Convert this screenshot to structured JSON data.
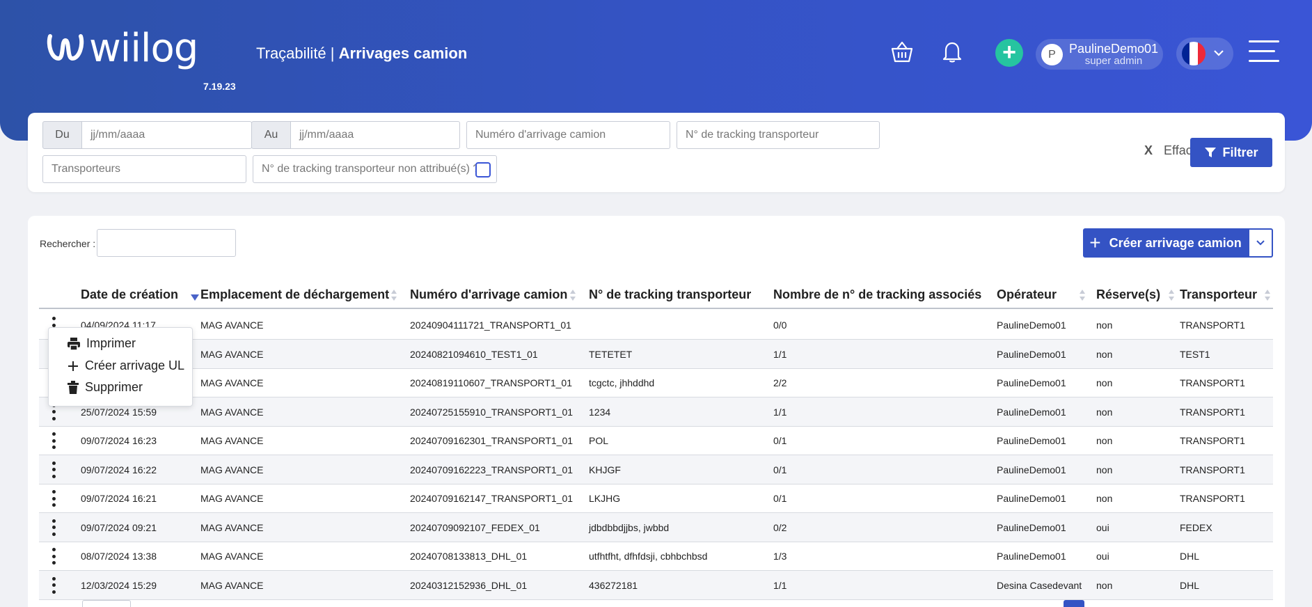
{
  "app": {
    "logo_text": "wiilog",
    "version": "7.19.23",
    "title_section": "Traçabilité |",
    "title_page": "Arrivages camion"
  },
  "header": {
    "user_initial": "P",
    "user_name": "PaulineDemo01",
    "user_role": "super admin",
    "add_label": "+",
    "language_flag_colors": [
      "#002395",
      "#ffffff",
      "#ed2939"
    ]
  },
  "filters": {
    "from_label": "Du",
    "from_placeholder": "jj/mm/aaaa",
    "to_label": "Au",
    "to_placeholder": "jj/mm/aaaa",
    "arrival_number_placeholder": "Numéro d'arrivage camion",
    "tracking_placeholder": "N° de tracking transporteur",
    "carriers_placeholder": "Transporteurs",
    "unassigned_tracking_label": "N° de tracking transporteur non attribué(s) ?",
    "clear_x": "X",
    "clear_label": "Effacer",
    "filter_label": "Filtrer"
  },
  "table_toolbar": {
    "search_label": "Rechercher :",
    "create_label": "Créer arrivage camion"
  },
  "table": {
    "columns": [
      "Date de création",
      "Emplacement de déchargement",
      "Numéro d'arrivage camion",
      "N° de tracking transporteur",
      "Nombre de n° de tracking associés",
      "Opérateur",
      "Réserve(s)",
      "Transporteur"
    ],
    "rows": [
      {
        "date": "04/09/2024 11:17",
        "location": "MAG AVANCE",
        "number": "20240904111721_TRANSPORT1_01",
        "tracking": "",
        "count": "0/0",
        "operator": "PaulineDemo01",
        "reserve": "non",
        "carrier": "TRANSPORT1"
      },
      {
        "date": "",
        "location": "MAG AVANCE",
        "number": "20240821094610_TEST1_01",
        "tracking": "TETETET",
        "count": "1/1",
        "operator": "PaulineDemo01",
        "reserve": "non",
        "carrier": "TEST1"
      },
      {
        "date": "",
        "location": "MAG AVANCE",
        "number": "20240819110607_TRANSPORT1_01",
        "tracking": "tcgctc, jhhddhd",
        "count": "2/2",
        "operator": "PaulineDemo01",
        "reserve": "non",
        "carrier": "TRANSPORT1"
      },
      {
        "date": "25/07/2024 15:59",
        "location": "MAG AVANCE",
        "number": "20240725155910_TRANSPORT1_01",
        "tracking": "1234",
        "count": "1/1",
        "operator": "PaulineDemo01",
        "reserve": "non",
        "carrier": "TRANSPORT1"
      },
      {
        "date": "09/07/2024 16:23",
        "location": "MAG AVANCE",
        "number": "20240709162301_TRANSPORT1_01",
        "tracking": "POL",
        "count": "0/1",
        "operator": "PaulineDemo01",
        "reserve": "non",
        "carrier": "TRANSPORT1"
      },
      {
        "date": "09/07/2024 16:22",
        "location": "MAG AVANCE",
        "number": "20240709162223_TRANSPORT1_01",
        "tracking": "KHJGF",
        "count": "0/1",
        "operator": "PaulineDemo01",
        "reserve": "non",
        "carrier": "TRANSPORT1"
      },
      {
        "date": "09/07/2024 16:21",
        "location": "MAG AVANCE",
        "number": "20240709162147_TRANSPORT1_01",
        "tracking": "LKJHG",
        "count": "0/1",
        "operator": "PaulineDemo01",
        "reserve": "non",
        "carrier": "TRANSPORT1"
      },
      {
        "date": "09/07/2024 09:21",
        "location": "MAG AVANCE",
        "number": "20240709092107_FEDEX_01",
        "tracking": "jdbdbbdjjbs, jwbbd",
        "count": "0/2",
        "operator": "PaulineDemo01",
        "reserve": "oui",
        "carrier": "FEDEX"
      },
      {
        "date": "08/07/2024 13:38",
        "location": "MAG AVANCE",
        "number": "20240708133813_DHL_01",
        "tracking": "utfhtfht, dfhfdsji, cbhbchbsd",
        "count": "1/3",
        "operator": "PaulineDemo01",
        "reserve": "oui",
        "carrier": "DHL"
      },
      {
        "date": "12/03/2024 15:29",
        "location": "MAG AVANCE",
        "number": "20240312152936_DHL_01",
        "tracking": "436272181",
        "count": "1/1",
        "operator": "Desina Casedevant",
        "reserve": "non",
        "carrier": "DHL"
      }
    ]
  },
  "context_menu": {
    "print_label": "Imprimer",
    "create_ul_label": "Créer arrivage UL",
    "delete_label": "Supprimer"
  }
}
